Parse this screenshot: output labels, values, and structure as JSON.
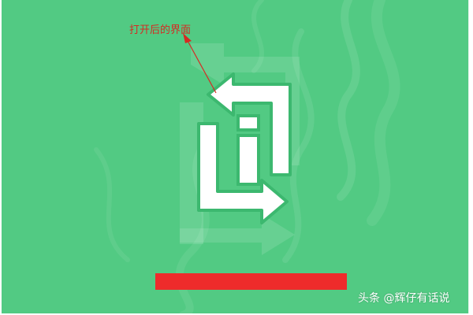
{
  "annotation": {
    "text": "打开后的界面"
  },
  "app": {
    "logo_icon": "refresh-info-icon"
  },
  "overlay": {
    "redaction_color": "#ee2b2b"
  },
  "colors": {
    "background": "#52ca83",
    "annotation": "#d62a22"
  },
  "watermark": {
    "text": "头条 @辉仔有话说"
  }
}
